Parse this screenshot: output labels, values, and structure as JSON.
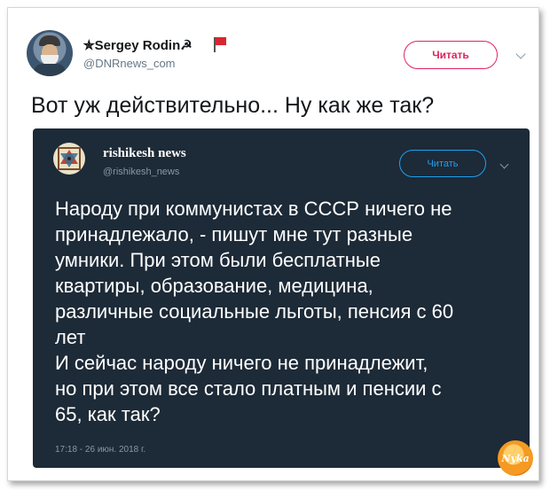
{
  "tweet": {
    "author_name": "✯Sergey Rodin☭",
    "handle": "@DNRnews_com",
    "follow_label": "Читать",
    "text": "Вот уж действительно... Ну как же так?"
  },
  "quoted": {
    "author_name": "rishikesh news",
    "handle": "@rishikesh_news",
    "follow_label": "Читать",
    "lines": [
      "Народу при коммунистах в СССР ничего не",
      "принадлежало, - пишут мне тут разные",
      "умники. При этом были бесплатные",
      "квартиры, образование, медицина,",
      "различные социальные льготы, пенсия с 60",
      "лет",
      "И сейчас народу ничего не принадлежит,",
      "но при этом все стало платным и пенсии с",
      "65, как так?"
    ],
    "timestamp": "17:18 - 26 июн. 2018 г."
  },
  "watermark": "Nyka",
  "colors": {
    "follow_primary": "#e0245e",
    "follow_embed": "#1da1f2",
    "embed_bg": "#1d2a37",
    "flag": "#d8262e"
  }
}
